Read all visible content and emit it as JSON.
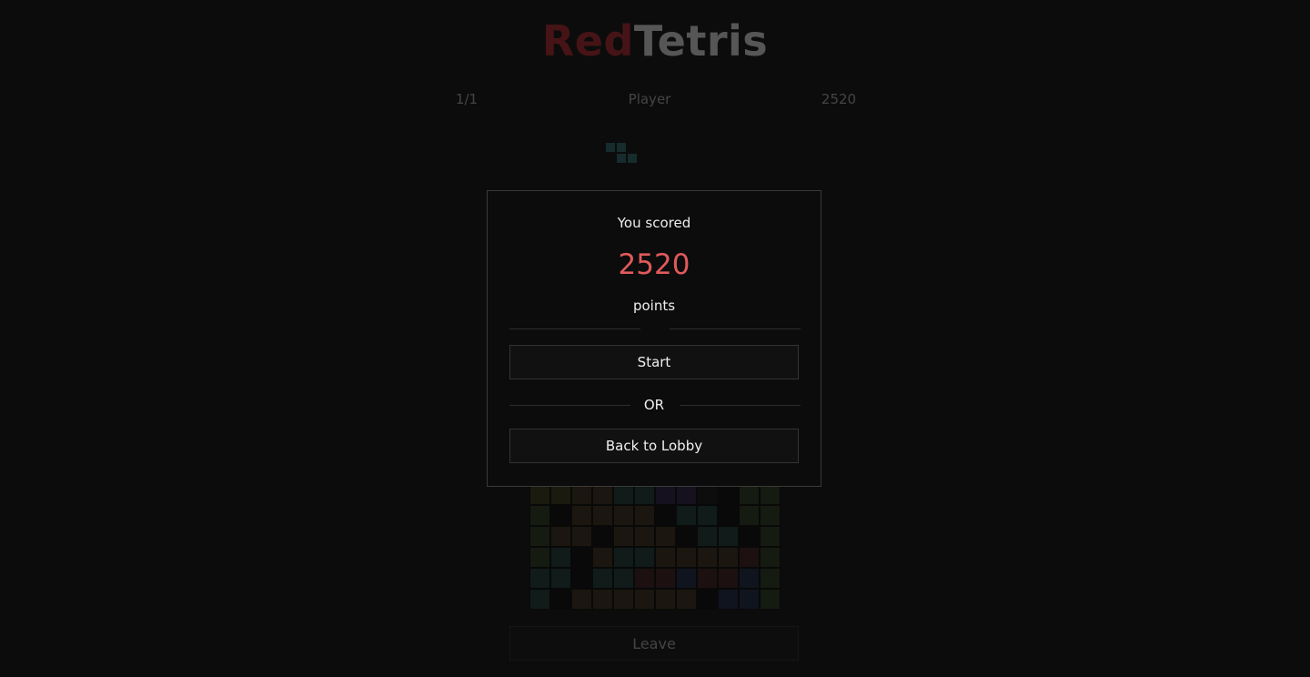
{
  "header": {
    "title_part1": "Red",
    "title_part2": "Tetris"
  },
  "info_bar": {
    "left": "1/1",
    "player": "Player",
    "score": "2520"
  },
  "board": {
    "rows": 6,
    "cols": 12,
    "cells": [
      "yyooccppe_gg",
      "g_oooo_cc_gg",
      "goo_ooo_cc_g",
      "gc_occoooorg",
      "cc_ccrrbrrbg",
      "c_oooooo_bbg"
    ],
    "colors": {
      "y": "#3a3a17",
      "o": "#3b2b18",
      "c": "#1b3b3a",
      "p": "#2a1e44",
      "g": "#283c1c",
      "r": "#3e1b1e",
      "b": "#1b2744",
      "e": "#111111",
      "_": "#050505"
    }
  },
  "game": {
    "leave_label": "Leave"
  },
  "modal": {
    "you_scored": "You scored",
    "score": "2520",
    "points": "points",
    "start_label": "Start",
    "or_label": "OR",
    "lobby_label": "Back to Lobby"
  }
}
